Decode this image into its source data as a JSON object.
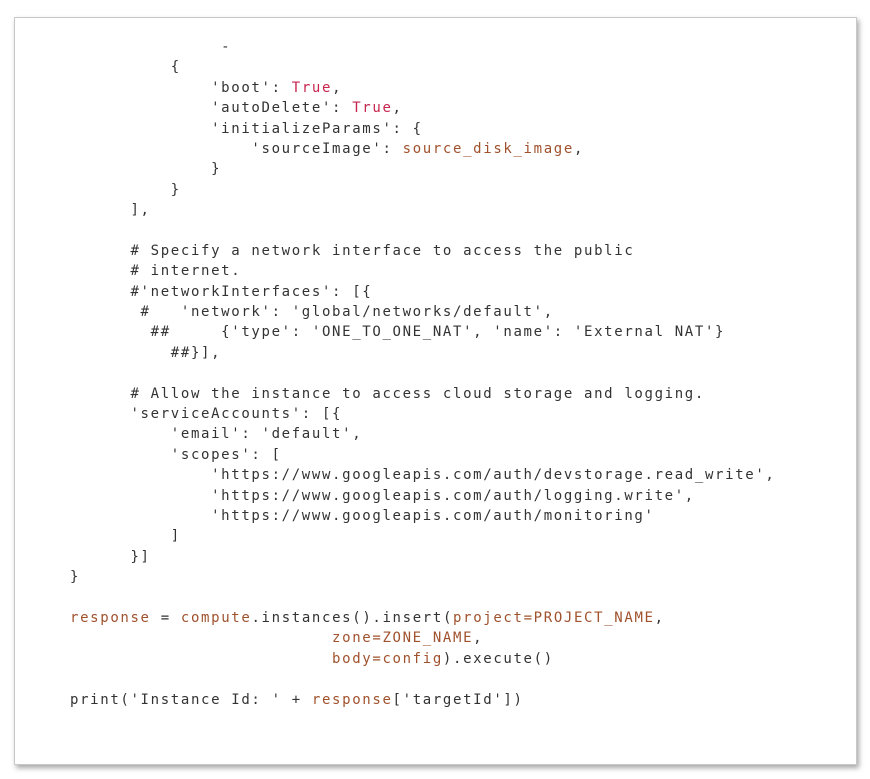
{
  "colors": {
    "default": "#333333",
    "keyword_literal": "#c7254e",
    "variable": "#a0522d"
  },
  "code_lines": [
    [
      {
        "t": "               -",
        "c": "k"
      }
    ],
    [
      {
        "t": "          {",
        "c": "k"
      }
    ],
    [
      {
        "t": "              'boot': ",
        "c": "k"
      },
      {
        "t": "True",
        "c": "r"
      },
      {
        "t": ",",
        "c": "k"
      }
    ],
    [
      {
        "t": "              'autoDelete': ",
        "c": "k"
      },
      {
        "t": "True",
        "c": "r"
      },
      {
        "t": ",",
        "c": "k"
      }
    ],
    [
      {
        "t": "              'initializeParams': {",
        "c": "k"
      }
    ],
    [
      {
        "t": "                  'sourceImage': ",
        "c": "k"
      },
      {
        "t": "source_disk_image",
        "c": "v"
      },
      {
        "t": ",",
        "c": "k"
      }
    ],
    [
      {
        "t": "              }",
        "c": "k"
      }
    ],
    [
      {
        "t": "          }",
        "c": "k"
      }
    ],
    [
      {
        "t": "      ],",
        "c": "k"
      }
    ],
    [],
    [
      {
        "t": "      # Specify a network interface to access the public",
        "c": "k"
      }
    ],
    [
      {
        "t": "      # internet.",
        "c": "k"
      }
    ],
    [
      {
        "t": "      #'networkInterfaces': [{",
        "c": "k"
      }
    ],
    [
      {
        "t": "       #   'network': 'global/networks/default',",
        "c": "k"
      }
    ],
    [
      {
        "t": "        ##     {'type': 'ONE_TO_ONE_NAT', 'name': 'External NAT'}",
        "c": "k"
      }
    ],
    [
      {
        "t": "          ##}],",
        "c": "k"
      }
    ],
    [],
    [
      {
        "t": "      # Allow the instance to access cloud storage and logging.",
        "c": "k"
      }
    ],
    [
      {
        "t": "      'serviceAccounts': [{",
        "c": "k"
      }
    ],
    [
      {
        "t": "          'email': 'default',",
        "c": "k"
      }
    ],
    [
      {
        "t": "          'scopes': [",
        "c": "k"
      }
    ],
    [
      {
        "t": "              'https://www.googleapis.com/auth/devstorage.read_write',",
        "c": "k"
      }
    ],
    [
      {
        "t": "              'https://www.googleapis.com/auth/logging.write',",
        "c": "k"
      }
    ],
    [
      {
        "t": "              'https://www.googleapis.com/auth/monitoring'",
        "c": "k"
      }
    ],
    [
      {
        "t": "          ]",
        "c": "k"
      }
    ],
    [
      {
        "t": "      }]",
        "c": "k"
      }
    ],
    [
      {
        "t": "}",
        "c": "k"
      }
    ],
    [],
    [
      {
        "t": "response",
        "c": "v"
      },
      {
        "t": " = ",
        "c": "k"
      },
      {
        "t": "compute",
        "c": "v"
      },
      {
        "t": ".instances().insert(",
        "c": "k"
      },
      {
        "t": "project=PROJECT_NAME",
        "c": "v"
      },
      {
        "t": ",",
        "c": "k"
      }
    ],
    [
      {
        "t": "                          ",
        "c": "k"
      },
      {
        "t": "zone=ZONE_NAME",
        "c": "v"
      },
      {
        "t": ",",
        "c": "k"
      }
    ],
    [
      {
        "t": "                          ",
        "c": "k"
      },
      {
        "t": "body=config",
        "c": "v"
      },
      {
        "t": ").execute()",
        "c": "k"
      }
    ],
    [],
    [
      {
        "t": "print('Instance Id: ' + ",
        "c": "k"
      },
      {
        "t": "response",
        "c": "v"
      },
      {
        "t": "['targetId'])",
        "c": "k"
      }
    ]
  ]
}
